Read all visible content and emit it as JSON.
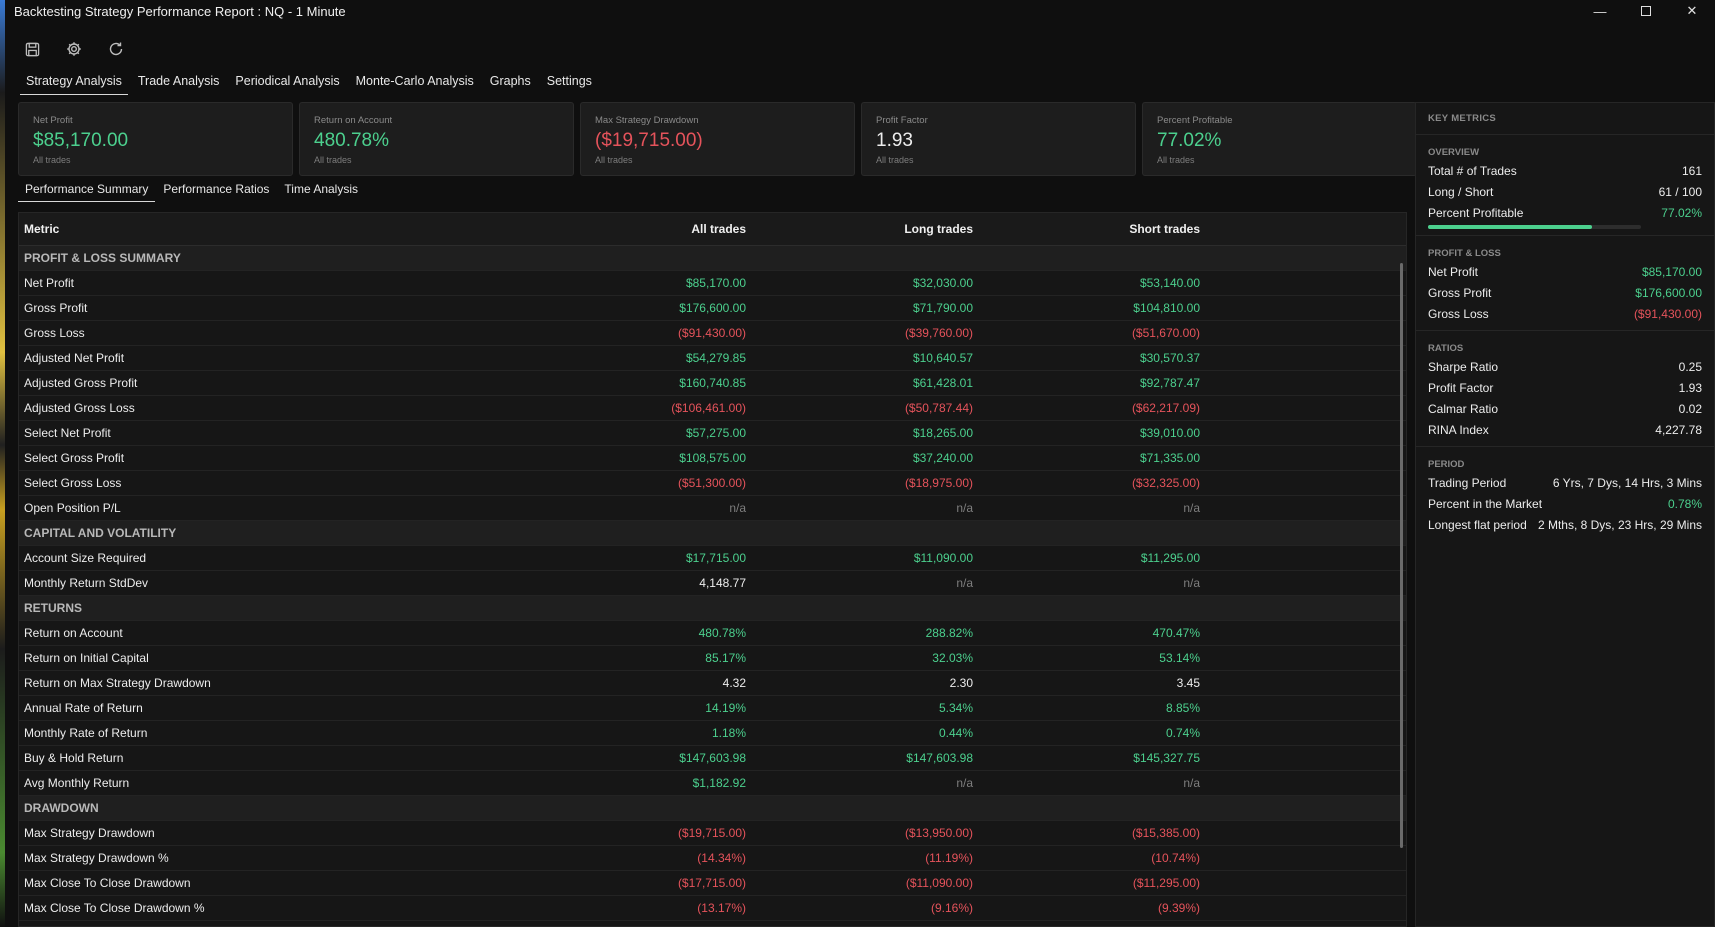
{
  "window": {
    "title": "Backtesting Strategy Performance Report : NQ - 1 Minute"
  },
  "toolbar": {
    "icons": [
      "save-icon",
      "settings-icon",
      "refresh-icon"
    ]
  },
  "main_tabs": [
    {
      "label": "Strategy Analysis",
      "active": true
    },
    {
      "label": "Trade Analysis"
    },
    {
      "label": "Periodical Analysis"
    },
    {
      "label": "Monte-Carlo Analysis"
    },
    {
      "label": "Graphs"
    },
    {
      "label": "Settings"
    }
  ],
  "cards": [
    {
      "label": "Net Profit",
      "value": "$85,170.00",
      "sub": "All trades",
      "tone": "pos"
    },
    {
      "label": "Return on Account",
      "value": "480.78%",
      "sub": "All trades",
      "tone": "pos"
    },
    {
      "label": "Max Strategy Drawdown",
      "value": "($19,715.00)",
      "sub": "All trades",
      "tone": "neg"
    },
    {
      "label": "Profit Factor",
      "value": "1.93",
      "sub": "All trades",
      "tone": "neu"
    },
    {
      "label": "Percent Profitable",
      "value": "77.02%",
      "sub": "All trades",
      "tone": "pos"
    }
  ],
  "sub_tabs": [
    {
      "label": "Performance Summary",
      "active": true
    },
    {
      "label": "Performance Ratios"
    },
    {
      "label": "Time Analysis"
    }
  ],
  "table": {
    "headers": [
      "Metric",
      "All trades",
      "Long trades",
      "Short trades"
    ],
    "rows": [
      {
        "section": "PROFIT & LOSS SUMMARY"
      },
      {
        "metric": "Net Profit",
        "cells": [
          [
            "$85,170.00",
            "pos"
          ],
          [
            "$32,030.00",
            "pos"
          ],
          [
            "$53,140.00",
            "pos"
          ]
        ]
      },
      {
        "metric": "Gross Profit",
        "cells": [
          [
            "$176,600.00",
            "pos"
          ],
          [
            "$71,790.00",
            "pos"
          ],
          [
            "$104,810.00",
            "pos"
          ]
        ]
      },
      {
        "metric": "Gross Loss",
        "cells": [
          [
            "($91,430.00)",
            "neg"
          ],
          [
            "($39,760.00)",
            "neg"
          ],
          [
            "($51,670.00)",
            "neg"
          ]
        ]
      },
      {
        "metric": "Adjusted Net Profit",
        "cells": [
          [
            "$54,279.85",
            "pos"
          ],
          [
            "$10,640.57",
            "pos"
          ],
          [
            "$30,570.37",
            "pos"
          ]
        ]
      },
      {
        "metric": "Adjusted Gross Profit",
        "cells": [
          [
            "$160,740.85",
            "pos"
          ],
          [
            "$61,428.01",
            "pos"
          ],
          [
            "$92,787.47",
            "pos"
          ]
        ]
      },
      {
        "metric": "Adjusted Gross Loss",
        "cells": [
          [
            "($106,461.00)",
            "neg"
          ],
          [
            "($50,787.44)",
            "neg"
          ],
          [
            "($62,217.09)",
            "neg"
          ]
        ]
      },
      {
        "metric": "Select Net Profit",
        "cells": [
          [
            "$57,275.00",
            "pos"
          ],
          [
            "$18,265.00",
            "pos"
          ],
          [
            "$39,010.00",
            "pos"
          ]
        ]
      },
      {
        "metric": "Select Gross Profit",
        "cells": [
          [
            "$108,575.00",
            "pos"
          ],
          [
            "$37,240.00",
            "pos"
          ],
          [
            "$71,335.00",
            "pos"
          ]
        ]
      },
      {
        "metric": "Select Gross Loss",
        "cells": [
          [
            "($51,300.00)",
            "neg"
          ],
          [
            "($18,975.00)",
            "neg"
          ],
          [
            "($32,325.00)",
            "neg"
          ]
        ]
      },
      {
        "metric": "Open Position P/L",
        "cells": [
          [
            "n/a",
            "na"
          ],
          [
            "n/a",
            "na"
          ],
          [
            "n/a",
            "na"
          ]
        ]
      },
      {
        "section": "CAPITAL AND VOLATILITY"
      },
      {
        "metric": "Account Size Required",
        "cells": [
          [
            "$17,715.00",
            "pos"
          ],
          [
            "$11,090.00",
            "pos"
          ],
          [
            "$11,295.00",
            "pos"
          ]
        ]
      },
      {
        "metric": "Monthly Return StdDev",
        "cells": [
          [
            "4,148.77",
            "neu"
          ],
          [
            "n/a",
            "na"
          ],
          [
            "n/a",
            "na"
          ]
        ]
      },
      {
        "section": "RETURNS"
      },
      {
        "metric": "Return on Account",
        "cells": [
          [
            "480.78%",
            "pos"
          ],
          [
            "288.82%",
            "pos"
          ],
          [
            "470.47%",
            "pos"
          ]
        ]
      },
      {
        "metric": "Return on Initial Capital",
        "cells": [
          [
            "85.17%",
            "pos"
          ],
          [
            "32.03%",
            "pos"
          ],
          [
            "53.14%",
            "pos"
          ]
        ]
      },
      {
        "metric": "Return on Max Strategy Drawdown",
        "cells": [
          [
            "4.32",
            "neu"
          ],
          [
            "2.30",
            "neu"
          ],
          [
            "3.45",
            "neu"
          ]
        ]
      },
      {
        "metric": "Annual Rate of Return",
        "cells": [
          [
            "14.19%",
            "pos"
          ],
          [
            "5.34%",
            "pos"
          ],
          [
            "8.85%",
            "pos"
          ]
        ]
      },
      {
        "metric": "Monthly Rate of Return",
        "cells": [
          [
            "1.18%",
            "pos"
          ],
          [
            "0.44%",
            "pos"
          ],
          [
            "0.74%",
            "pos"
          ]
        ]
      },
      {
        "metric": "Buy & Hold Return",
        "cells": [
          [
            "$147,603.98",
            "pos"
          ],
          [
            "$147,603.98",
            "pos"
          ],
          [
            "$145,327.75",
            "pos"
          ]
        ]
      },
      {
        "metric": "Avg Monthly Return",
        "cells": [
          [
            "$1,182.92",
            "pos"
          ],
          [
            "n/a",
            "na"
          ],
          [
            "n/a",
            "na"
          ]
        ]
      },
      {
        "section": "DRAWDOWN"
      },
      {
        "metric": "Max Strategy Drawdown",
        "cells": [
          [
            "($19,715.00)",
            "neg"
          ],
          [
            "($13,950.00)",
            "neg"
          ],
          [
            "($15,385.00)",
            "neg"
          ]
        ]
      },
      {
        "metric": "Max Strategy Drawdown %",
        "cells": [
          [
            "(14.34%)",
            "neg"
          ],
          [
            "(11.19%)",
            "neg"
          ],
          [
            "(10.74%)",
            "neg"
          ]
        ]
      },
      {
        "metric": "Max Close To Close Drawdown",
        "cells": [
          [
            "($17,715.00)",
            "neg"
          ],
          [
            "($11,090.00)",
            "neg"
          ],
          [
            "($11,295.00)",
            "neg"
          ]
        ]
      },
      {
        "metric": "Max Close To Close Drawdown %",
        "cells": [
          [
            "(13.17%)",
            "neg"
          ],
          [
            "(9.16%)",
            "neg"
          ],
          [
            "(9.39%)",
            "neg"
          ]
        ]
      }
    ]
  },
  "key_metrics": {
    "header": "KEY METRICS",
    "overview": {
      "title": "OVERVIEW",
      "items": [
        {
          "label": "Total # of Trades",
          "value": "161",
          "tone": "neu"
        },
        {
          "label": "Long / Short",
          "value": "61 / 100",
          "tone": "neu"
        },
        {
          "label": "Percent Profitable",
          "value": "77.02%",
          "tone": "pos"
        }
      ],
      "progress_fraction": 0.7702
    },
    "profit_loss": {
      "title": "PROFIT & LOSS",
      "items": [
        {
          "label": "Net Profit",
          "value": "$85,170.00",
          "tone": "pos"
        },
        {
          "label": "Gross Profit",
          "value": "$176,600.00",
          "tone": "pos"
        },
        {
          "label": "Gross Loss",
          "value": "($91,430.00)",
          "tone": "neg"
        }
      ]
    },
    "ratios": {
      "title": "RATIOS",
      "items": [
        {
          "label": "Sharpe Ratio",
          "value": "0.25",
          "tone": "neu"
        },
        {
          "label": "Profit Factor",
          "value": "1.93",
          "tone": "neu"
        },
        {
          "label": "Calmar Ratio",
          "value": "0.02",
          "tone": "neu"
        },
        {
          "label": "RINA Index",
          "value": "4,227.78",
          "tone": "neu"
        }
      ]
    },
    "period": {
      "title": "PERIOD",
      "items": [
        {
          "label": "Trading Period",
          "value": "6 Yrs, 7 Dys, 14 Hrs, 3 Mins",
          "tone": "neu"
        },
        {
          "label": "Percent in the Market",
          "value": "0.78%",
          "tone": "pos"
        },
        {
          "label": "Longest flat period",
          "value": "2 Mths, 8 Dys, 23 Hrs, 29 Mins",
          "tone": "neu"
        }
      ]
    }
  },
  "colors": {
    "positive": "#4cd08e",
    "negative": "#e5535b",
    "muted": "#7e7e7e",
    "background": "#0f0f0f"
  }
}
